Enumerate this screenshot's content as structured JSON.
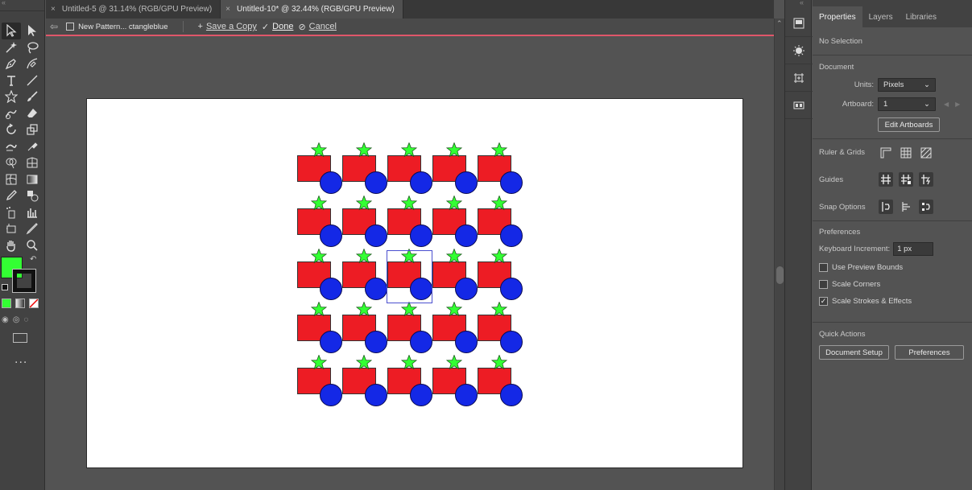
{
  "tabs": [
    {
      "close": "×",
      "label": "Untitled-5 @ 31.14% (RGB/GPU Preview)"
    },
    {
      "close": "×",
      "label": "Untitled-10* @ 32.44% (RGB/GPU Preview)"
    }
  ],
  "pattern_bar": {
    "name": "New Pattern... ctangleblue",
    "save_copy": "Save a Copy",
    "done": "Done",
    "cancel": "Cancel"
  },
  "artwork": {
    "star_color": "#33ff33",
    "rect_color": "#ed1c24",
    "circle_color": "#1428e6"
  },
  "toolbar": {
    "fill_color": "#33ff33",
    "more": "..."
  },
  "panel": {
    "tabs": [
      "Properties",
      "Layers",
      "Libraries"
    ],
    "selection": "No Selection",
    "document_title": "Document",
    "units_label": "Units:",
    "units_value": "Pixels",
    "artboard_label": "Artboard:",
    "artboard_value": "1",
    "edit_artboards": "Edit Artboards",
    "ruler_grids": "Ruler & Grids",
    "guides": "Guides",
    "snap_options": "Snap Options",
    "preferences_title": "Preferences",
    "keyboard_increment_label": "Keyboard Increment:",
    "keyboard_increment_value": "1 px",
    "use_preview_bounds": "Use Preview Bounds",
    "scale_corners": "Scale Corners",
    "scale_strokes": "Scale Strokes & Effects",
    "quick_actions": "Quick Actions",
    "document_setup": "Document Setup",
    "preferences_btn": "Preferences",
    "check_use_preview_bounds": false,
    "check_scale_corners": false,
    "check_scale_strokes": true
  }
}
